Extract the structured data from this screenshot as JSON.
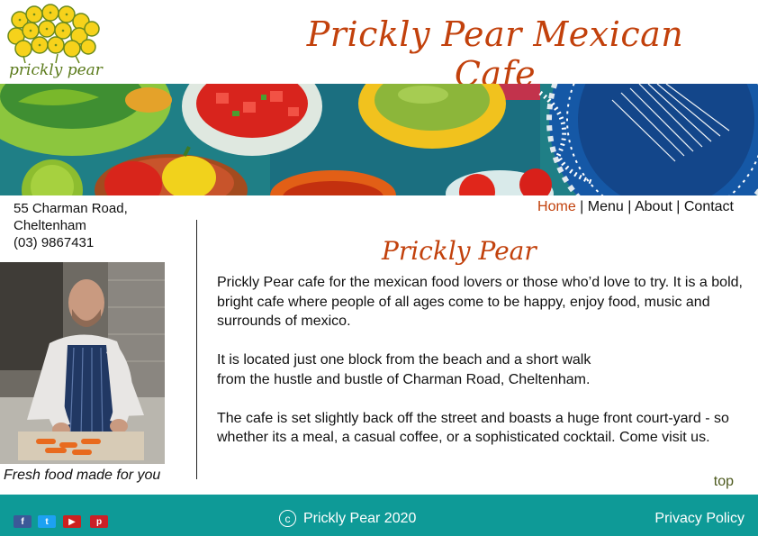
{
  "logo": {
    "text": "prickly pear"
  },
  "header": {
    "title": "Prickly Pear Mexican Cafe"
  },
  "address": {
    "street": "55 Charman Road,",
    "suburb": "Cheltenham",
    "phone": "(03) 9867431"
  },
  "nav": {
    "items": [
      {
        "label": "Home"
      },
      {
        "label": "Menu"
      },
      {
        "label": "About"
      },
      {
        "label": "Contact"
      }
    ],
    "separator": "|"
  },
  "sidebar": {
    "caption": "Fresh food made for you"
  },
  "content": {
    "heading": "Prickly Pear",
    "paragraphs": [
      "Prickly Pear cafe for the mexican food lovers or those who’d love to try. It is a bold, bright cafe where people of all ages come to be happy, enjoy food, music and surrounds of mexico.",
      "It is located just one block from the beach and a short walk\nfrom the hustle and bustle of Charman Road, Cheltenham.",
      "The cafe is set slightly back off the street and boasts a huge front court-yard - so whether its a meal, a casual coffee, or a sophisticated cocktail. Come visit us."
    ],
    "top_link": "top"
  },
  "footer": {
    "copyright_symbol": "c",
    "copyright": "Prickly Pear 2020",
    "privacy": "Privacy Policy",
    "social": [
      {
        "name": "facebook-icon",
        "glyph": "f",
        "color": "#3b5998"
      },
      {
        "name": "twitter-icon",
        "glyph": "t",
        "color": "#1da1f2"
      },
      {
        "name": "youtube-icon",
        "glyph": "▶",
        "color": "#cd201f"
      },
      {
        "name": "pinterest-icon",
        "glyph": "p",
        "color": "#cb2027"
      }
    ]
  },
  "colors": {
    "accent": "#c2410c",
    "footer": "#0e9a97",
    "top_link": "#4d5a1e"
  }
}
